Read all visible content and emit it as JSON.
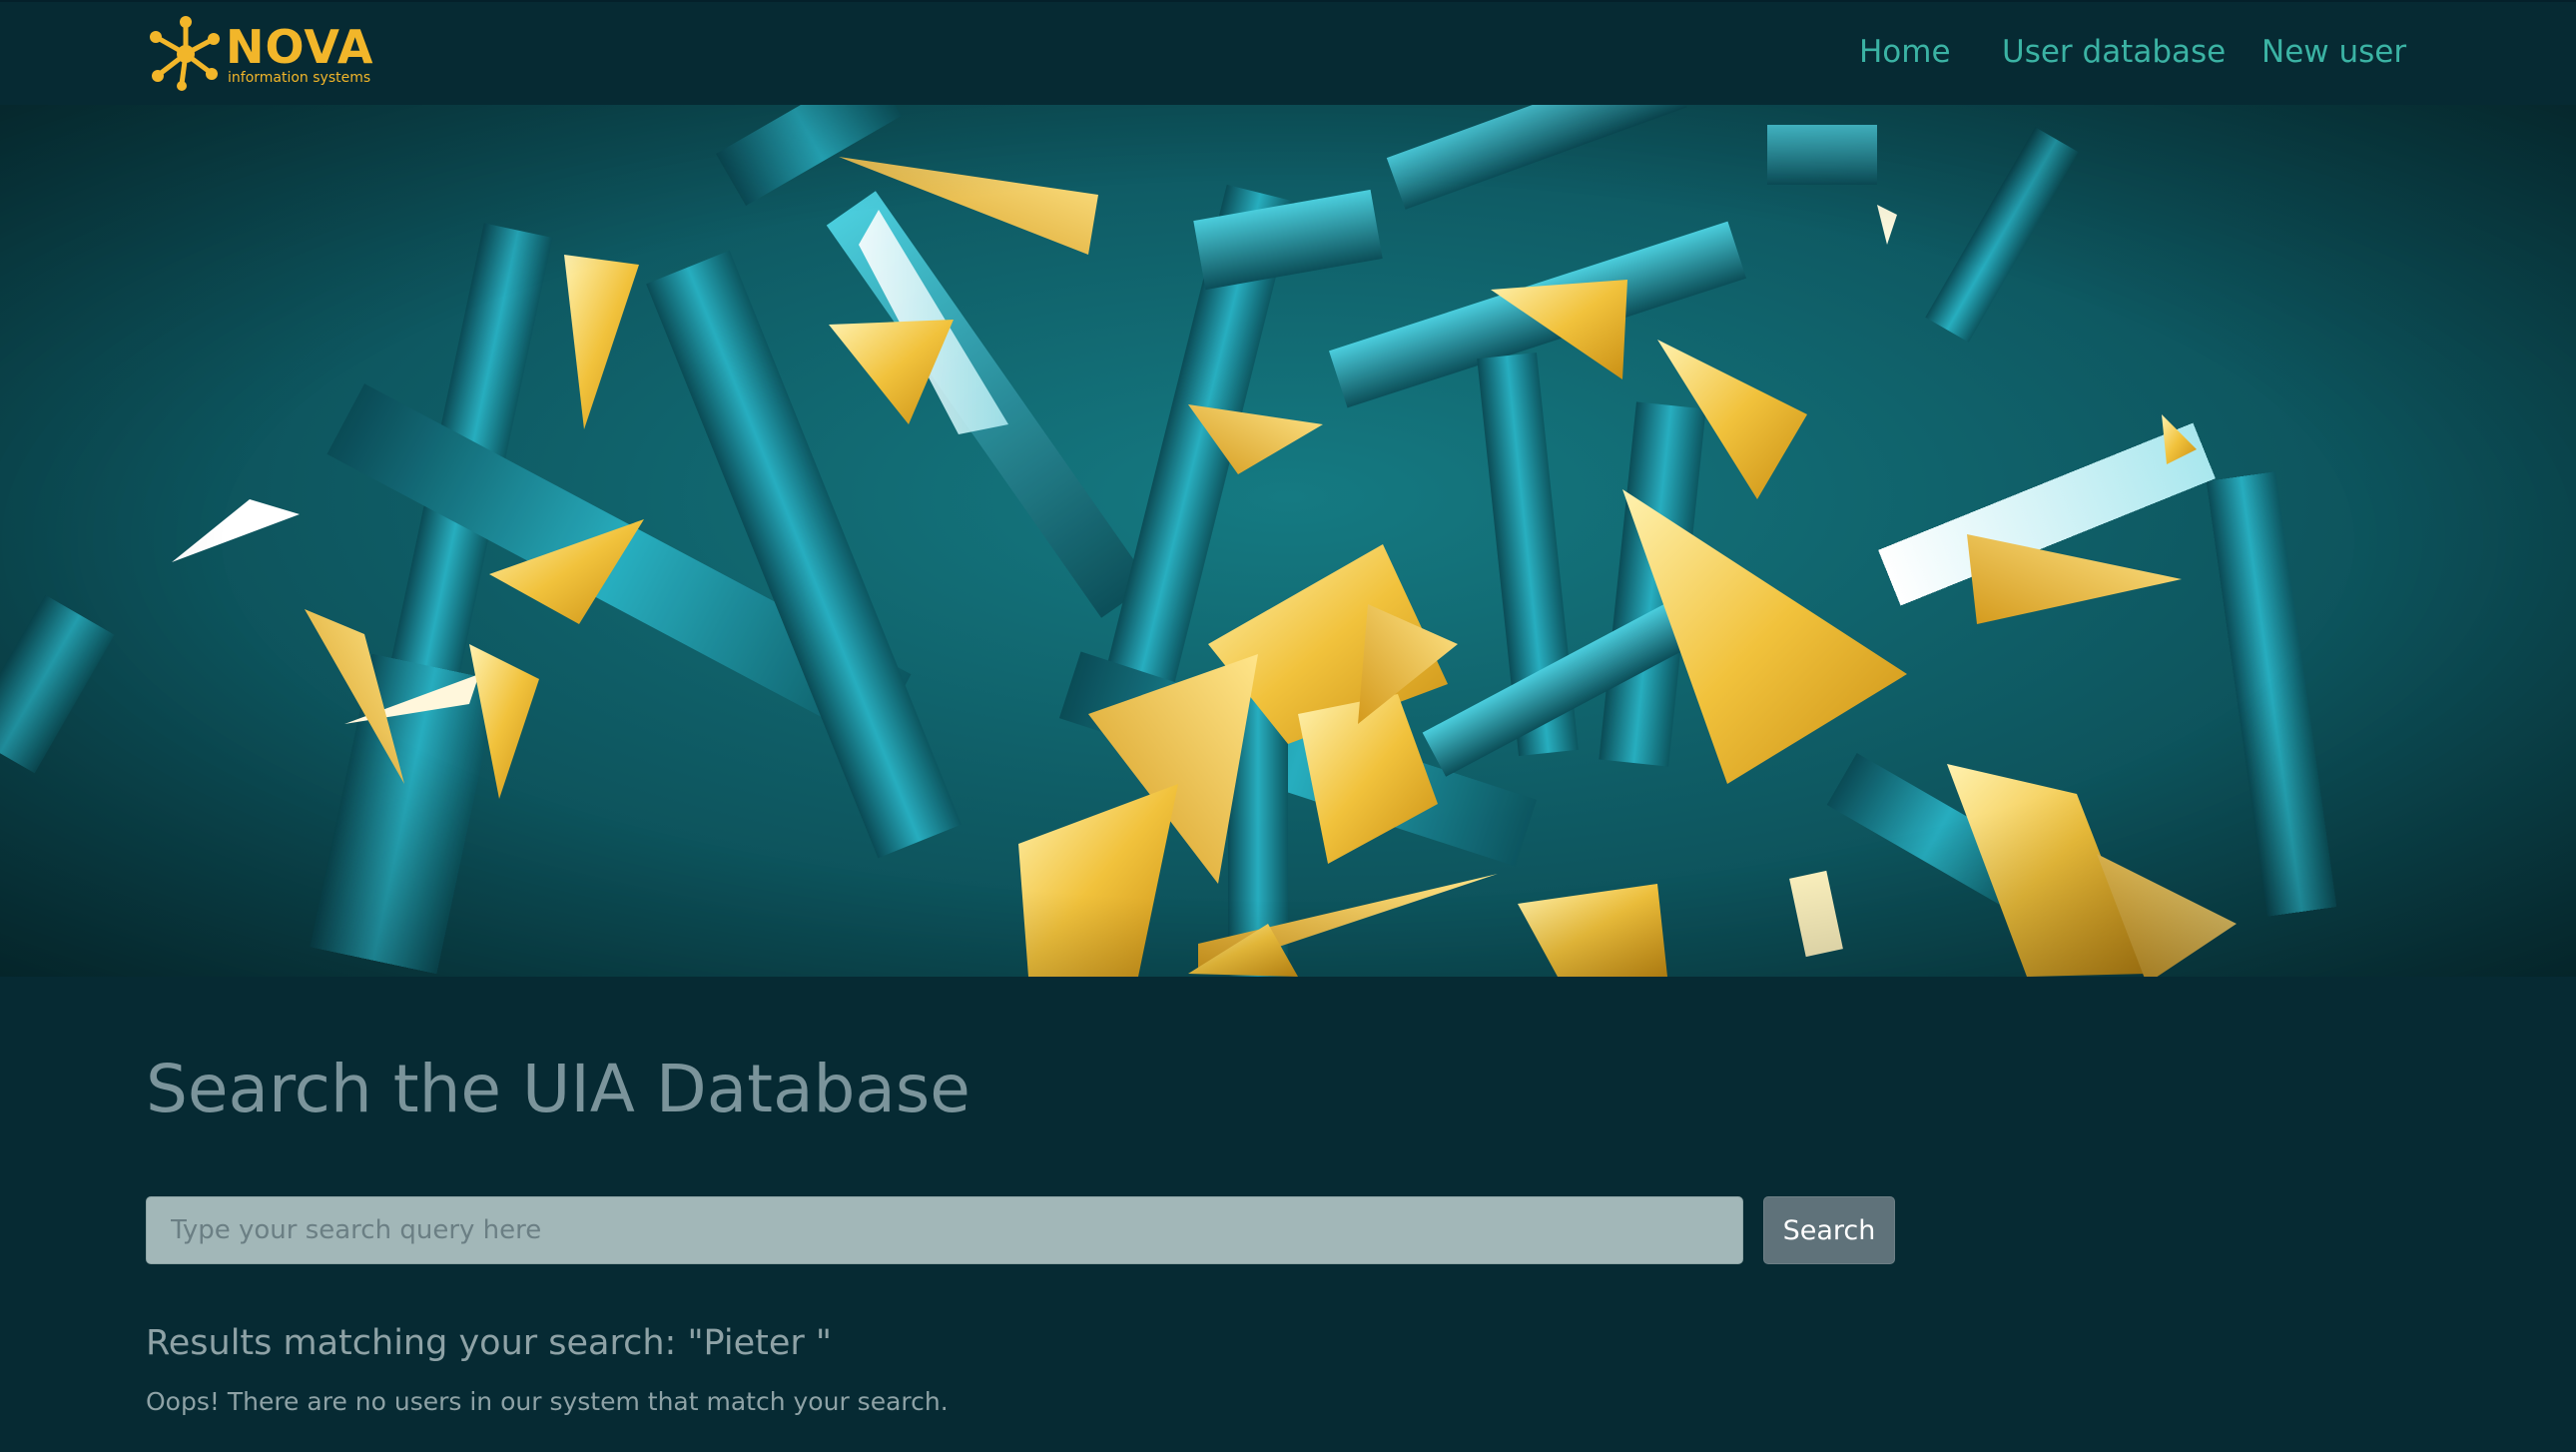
{
  "brand": {
    "name": "NOVA",
    "tagline": "information systems"
  },
  "nav": {
    "items": [
      {
        "label": "Home"
      },
      {
        "label": "User database"
      },
      {
        "label": "New user"
      }
    ]
  },
  "hero": {
    "image_icon": "abstract-crystal-shards-illustration"
  },
  "search": {
    "title": "Search the UIA Database",
    "placeholder": "Type your search query here",
    "value": "",
    "button_label": "Search"
  },
  "results": {
    "heading": "Results matching your search: \"Pieter \"",
    "empty_message": "Oops! There are no users in our system that match your search."
  },
  "colors": {
    "background": "#062a33",
    "accent_gold": "#f2b62a",
    "nav_link": "#3bb3a4",
    "hero_teal": "#157a82",
    "input_bg": "#a2b7b8",
    "button_bg": "#5f727a"
  }
}
